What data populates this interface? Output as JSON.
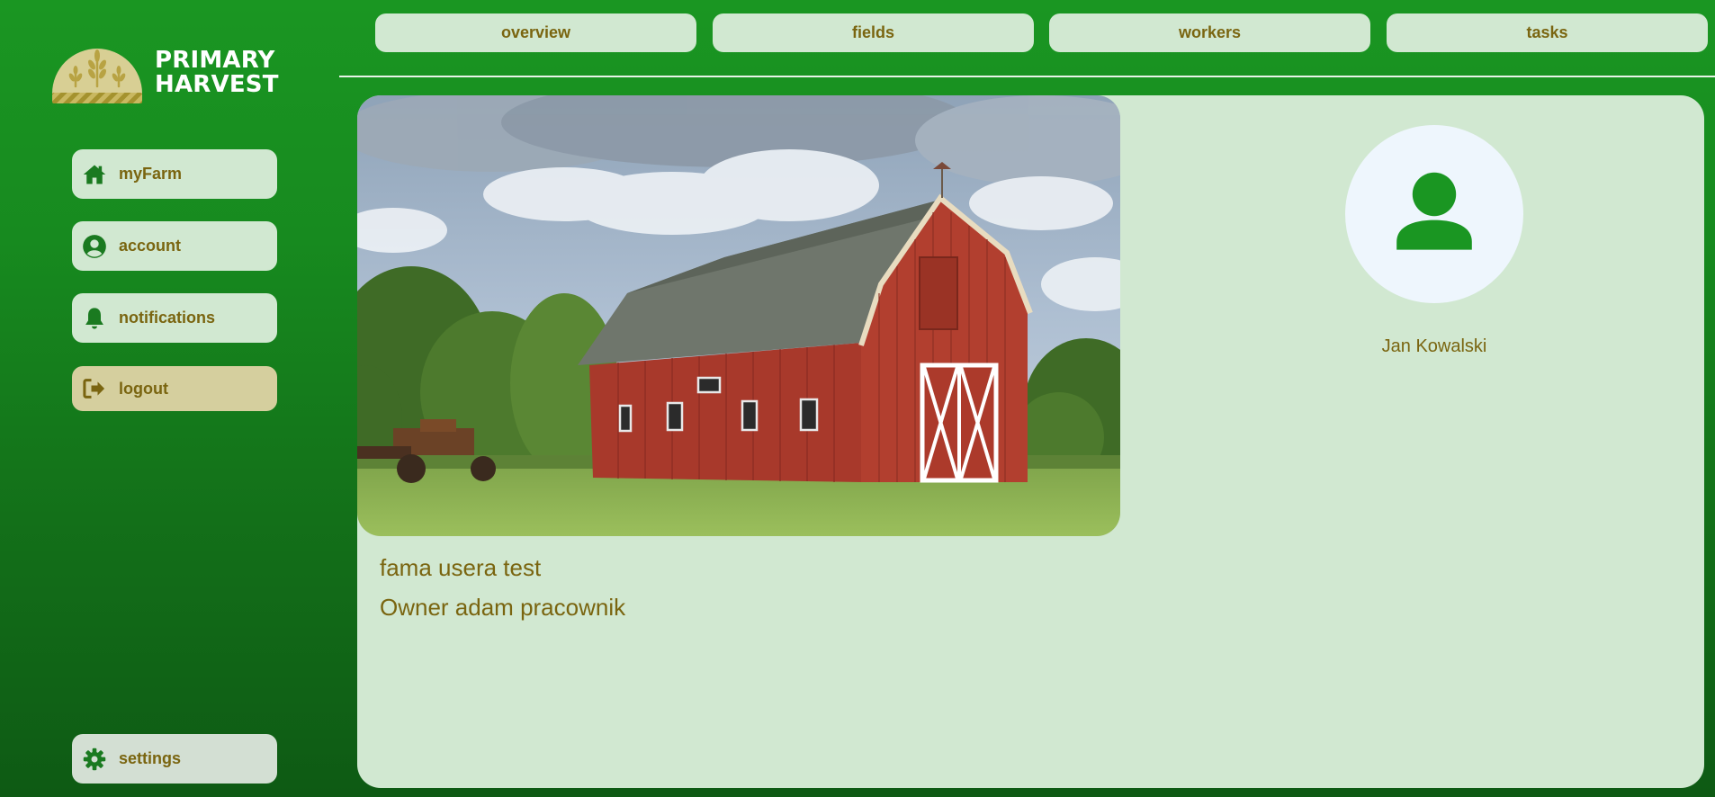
{
  "brand": {
    "line1": "PRIMARY",
    "line2": "HARVEST",
    "logo_icon": "wheat-sun-logo"
  },
  "sidebar": {
    "items": [
      {
        "label": "myFarm",
        "icon": "home-icon"
      },
      {
        "label": "account",
        "icon": "user-circle-icon"
      },
      {
        "label": "notifications",
        "icon": "bell-icon"
      },
      {
        "label": "logout",
        "icon": "logout-icon"
      }
    ],
    "settings": {
      "label": "settings",
      "icon": "gear-icon"
    }
  },
  "tabs": [
    {
      "label": "overview"
    },
    {
      "label": "fields"
    },
    {
      "label": "workers"
    },
    {
      "label": "tasks"
    }
  ],
  "farm": {
    "name": "fama usera test",
    "owner": "Owner adam pracownik"
  },
  "user": {
    "name": "Jan Kowalski",
    "avatar_icon": "user-avatar-icon"
  },
  "colors": {
    "primary_green": "#1a9622",
    "panel": "#d1e8d1",
    "text_olive": "#7a6510",
    "logout_bg": "#d5cf9e"
  }
}
